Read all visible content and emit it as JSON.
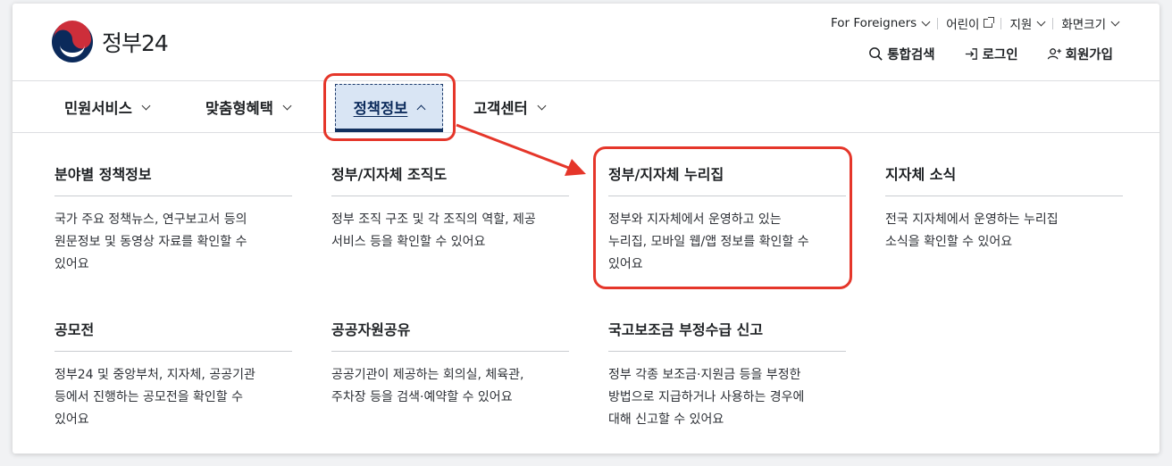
{
  "header": {
    "logo_text": "정부24",
    "util_links": [
      {
        "label": "For Foreigners"
      },
      {
        "label": "어린이"
      },
      {
        "label": "지원"
      },
      {
        "label": "화면크기"
      }
    ],
    "actions": [
      {
        "label": "통합검색",
        "icon": "search-icon"
      },
      {
        "label": "로그인",
        "icon": "login-icon"
      },
      {
        "label": "회원가입",
        "icon": "add-user-icon"
      }
    ]
  },
  "nav": {
    "items": [
      {
        "label": "민원서비스"
      },
      {
        "label": "맞춤형혜택"
      },
      {
        "label": "정책정보"
      },
      {
        "label": "고객센터"
      }
    ],
    "active": "정책정보"
  },
  "menu": {
    "cards": [
      {
        "title": "분야별 정책정보",
        "desc": [
          "국가 주요 정책뉴스, 연구보고서 등의",
          "원문정보 및 동영상 자료를 확인할 수",
          "있어요"
        ]
      },
      {
        "title": "정부/지자체 조직도",
        "desc": [
          "정부 조직 구조 및 각 조직의 역할, 제공",
          "서비스 등을 확인할 수 있어요"
        ]
      },
      {
        "title": "정부/지자체 누리집",
        "desc": [
          "정부와 지자체에서 운영하고 있는",
          "누리집, 모바일 웹/앱 정보를 확인할 수",
          "있어요"
        ]
      },
      {
        "title": "지자체 소식",
        "desc": [
          "전국 지자체에서 운영하는 누리집",
          "소식을 확인할 수 있어요"
        ]
      },
      {
        "title": "공모전",
        "desc": [
          "정부24 및 중앙부처, 지자체, 공공기관",
          "등에서 진행하는 공모전을 확인할 수",
          "있어요"
        ]
      },
      {
        "title": "공공자원공유",
        "desc": [
          "공공기관이 제공하는 회의실, 체육관,",
          "주차장 등을 검색·예약할 수 있어요"
        ]
      },
      {
        "title": "국고보조금 부정수급 신고",
        "desc": [
          "정부 각종 보조금·지원금 등을 부정한",
          "방법으로 지급하거나 사용하는 경우에",
          "대해 신고할 수 있어요"
        ]
      }
    ]
  },
  "colors": {
    "accent_red": "#e5362a",
    "nav_active_bg": "#d9e5f4",
    "nav_active_bar": "#13315f"
  }
}
